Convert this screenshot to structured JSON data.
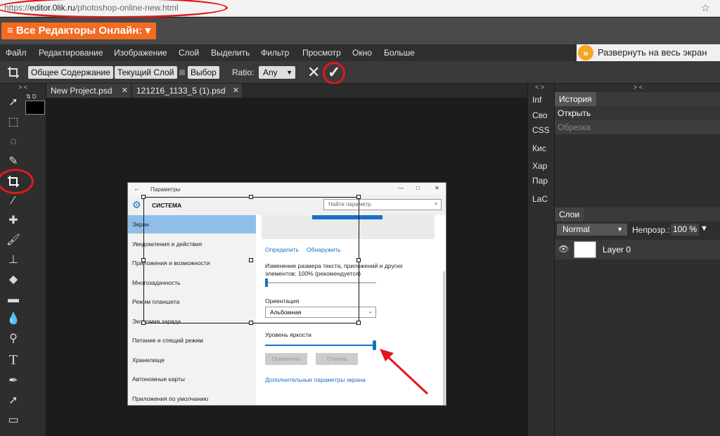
{
  "browser": {
    "url_prefix": "https://",
    "url_host": "editor.0lik.ru",
    "url_path": "/photoshop-online-new.html"
  },
  "topbar": {
    "editors_button": "≡ Все Редакторы Онлайн: ▾"
  },
  "menu": {
    "items": [
      "Файл",
      "Редактирование",
      "Изображение",
      "Слой",
      "Выделить",
      "Фильтр",
      "Просмотр",
      "Окно",
      "Больше"
    ],
    "expand_label": "Развернуть на весь экран"
  },
  "options": {
    "buttons": [
      "Общее Содержание",
      "Текущий Слой",
      "Выбор"
    ],
    "ratio_label": "Ratio:",
    "ratio_value": "Any",
    "cancel_icon": "✕",
    "confirm_icon": "✓"
  },
  "toolbox": {
    "collapse": "> <",
    "swap": "⇅ D"
  },
  "tabs": [
    {
      "label": "New Project.psd"
    },
    {
      "label": "121216_1133_5 (1).psd"
    }
  ],
  "image": {
    "window_title": "Параметры",
    "section": "СИСТЕМА",
    "search_placeholder": "Найти параметр",
    "sidebar": [
      "Экран",
      "Уведомления и действия",
      "Приложения и возможности",
      "Многозадачность",
      "Режим планшета",
      "Экономия заряда",
      "Питание и спящий режим",
      "Хранилище",
      "Автономные карты",
      "Приложения по умолчанию"
    ],
    "link_identify": "Определить",
    "link_detect": "Обнаружить",
    "scale_text_1": "Изменение размера текста, приложений и других",
    "scale_text_2": "элементов: 100% (рекомендуется)",
    "orientation_label": "Ориентация",
    "orientation_value": "Альбомная",
    "brightness_label": "Уровень яркости",
    "apply_button": "Применить",
    "cancel_button": "Отмена",
    "advanced_link": "Дополнительные параметры экрана",
    "brightness_level": 1.0
  },
  "right_a": {
    "collapse": "< >",
    "items": [
      "Inf",
      "Сво",
      "CSS",
      "Кис",
      "Хар",
      "Пар",
      "LaC"
    ]
  },
  "right_b": {
    "collapse": "> <",
    "history_tab": "История",
    "history_rows": [
      "Открыть",
      "Обрезка"
    ],
    "layers_tab": "Слои",
    "blend_mode": "Normal",
    "opacity_label": "Непрозр.:",
    "opacity_value": "100 %",
    "layer_name": "Layer 0"
  },
  "colors": {
    "accent": "#f26b21",
    "annotation": "#e0191f",
    "selection": "#8fbfe9",
    "link": "#1a6fc7"
  }
}
